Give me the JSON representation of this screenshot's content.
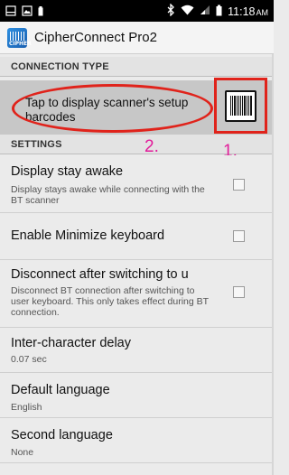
{
  "status_bar": {
    "time": "11:18",
    "time_suffix": "AM",
    "icons": [
      "screen-capture-icon",
      "gallery-icon",
      "battery-small-icon",
      "bluetooth-icon",
      "wifi-icon",
      "signal-icon",
      "battery-icon"
    ]
  },
  "app_bar": {
    "title": "CipherConnect Pro2",
    "icon_text": "CIPHER"
  },
  "connection_type": {
    "header": "CONNECTION TYPE",
    "tap_text": "Tap to display scanner's setup barcodes",
    "barcode_icon": "barcode-icon"
  },
  "annotations": {
    "step1": "1.",
    "step2": "2.",
    "color": "#e0231b",
    "label_color": "#e21b9a"
  },
  "settings": {
    "header": "SETTINGS",
    "items": [
      {
        "title": "Display stay awake",
        "subtitle": "Display stays awake while connecting with the BT scanner",
        "checked": false
      },
      {
        "title": "Enable Minimize keyboard",
        "subtitle": "",
        "checked": false
      },
      {
        "title": "Disconnect after switching to u",
        "subtitle": "Disconnect BT connection after switching to user keyboard. This only takes effect during BT connection.",
        "checked": false
      },
      {
        "title": "Inter-character delay",
        "subtitle": "0.07 sec"
      },
      {
        "title": "Default language",
        "subtitle": "English"
      },
      {
        "title": "Second language",
        "subtitle": "None"
      }
    ]
  }
}
